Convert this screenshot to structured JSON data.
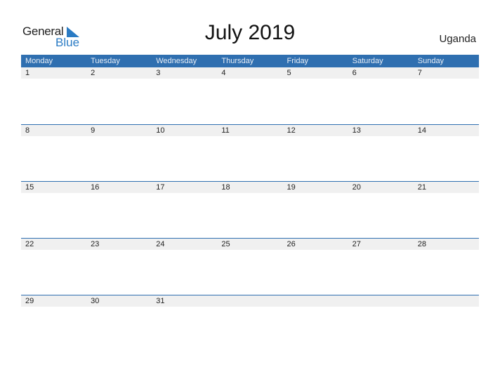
{
  "logo": {
    "word1": "General",
    "word2": "Blue"
  },
  "title": "July 2019",
  "country": "Uganda",
  "colors": {
    "accent": "#2f6fb0",
    "logo_blue": "#2a7bc4",
    "date_strip": "#f0f0f0"
  },
  "weekdays": [
    "Monday",
    "Tuesday",
    "Wednesday",
    "Thursday",
    "Friday",
    "Saturday",
    "Sunday"
  ],
  "weeks": [
    [
      "1",
      "2",
      "3",
      "4",
      "5",
      "6",
      "7"
    ],
    [
      "8",
      "9",
      "10",
      "11",
      "12",
      "13",
      "14"
    ],
    [
      "15",
      "16",
      "17",
      "18",
      "19",
      "20",
      "21"
    ],
    [
      "22",
      "23",
      "24",
      "25",
      "26",
      "27",
      "28"
    ],
    [
      "29",
      "30",
      "31",
      "",
      "",
      "",
      ""
    ]
  ]
}
